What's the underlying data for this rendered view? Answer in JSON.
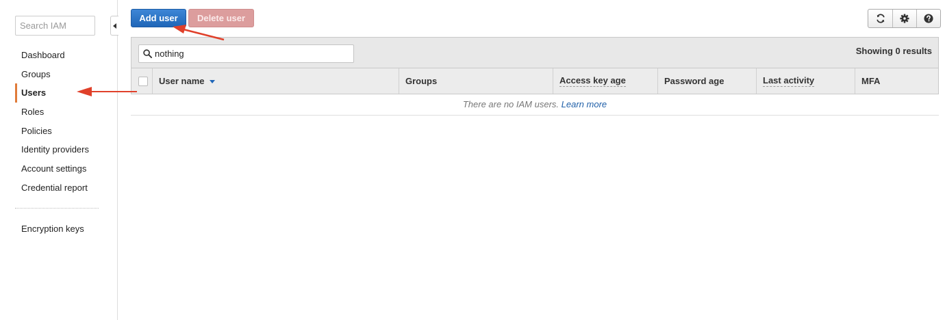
{
  "sidebar": {
    "search_placeholder": "Search IAM",
    "items": [
      {
        "label": "Dashboard",
        "active": false
      },
      {
        "label": "Groups",
        "active": false
      },
      {
        "label": "Users",
        "active": true
      },
      {
        "label": "Roles",
        "active": false
      },
      {
        "label": "Policies",
        "active": false
      },
      {
        "label": "Identity providers",
        "active": false
      },
      {
        "label": "Account settings",
        "active": false
      },
      {
        "label": "Credential report",
        "active": false
      }
    ],
    "secondary_items": [
      {
        "label": "Encryption keys"
      }
    ]
  },
  "toolbar": {
    "add_user_label": "Add user",
    "delete_user_label": "Delete user",
    "icons": [
      "refresh-icon",
      "gear-icon",
      "help-icon"
    ]
  },
  "filter": {
    "value": "nothing",
    "showing_text": "Showing 0 results"
  },
  "table": {
    "columns": [
      "User name",
      "Groups",
      "Access key age",
      "Password age",
      "Last activity",
      "MFA"
    ],
    "sorted_column": "User name",
    "empty_message": "There are no IAM users.",
    "empty_link": "Learn more"
  },
  "colors": {
    "primary": "#1f66b8",
    "active_accent": "#e07b39",
    "annotation_arrow": "#e0402a"
  }
}
